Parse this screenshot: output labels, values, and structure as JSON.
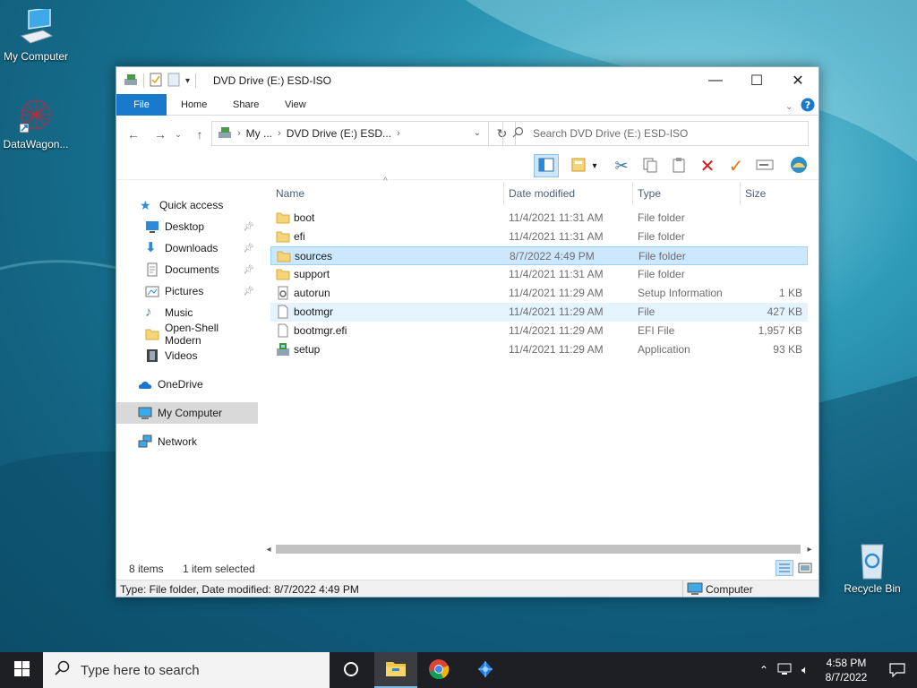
{
  "desktop": {
    "icons": [
      {
        "label": "My Computer"
      },
      {
        "label": "DataWagon..."
      },
      {
        "label": "Recycle Bin"
      }
    ]
  },
  "window": {
    "title": "DVD Drive (E:) ESD-ISO",
    "tabs": [
      "File",
      "Home",
      "Share",
      "View"
    ],
    "address": {
      "crumbs": [
        "My ...",
        "DVD Drive (E:) ESD..."
      ]
    },
    "search": {
      "placeholder": "Search DVD Drive (E:) ESD-ISO"
    },
    "nav": {
      "quick_access": "Quick access",
      "items": [
        {
          "label": "Desktop",
          "pinned": true
        },
        {
          "label": "Downloads",
          "pinned": true
        },
        {
          "label": "Documents",
          "pinned": true
        },
        {
          "label": "Pictures",
          "pinned": true
        },
        {
          "label": "Music",
          "pinned": false
        },
        {
          "label": "Open-Shell Modern",
          "pinned": false
        },
        {
          "label": "Videos",
          "pinned": false
        }
      ],
      "onedrive": "OneDrive",
      "my_computer": "My Computer",
      "network": "Network"
    },
    "columns": [
      "Name",
      "Date modified",
      "Type",
      "Size"
    ],
    "files": [
      {
        "name": "boot",
        "date": "11/4/2021 11:31 AM",
        "type": "File folder",
        "size": "",
        "icon": "folder-icon"
      },
      {
        "name": "efi",
        "date": "11/4/2021 11:31 AM",
        "type": "File folder",
        "size": "",
        "icon": "folder-icon"
      },
      {
        "name": "sources",
        "date": "8/7/2022 4:49 PM",
        "type": "File folder",
        "size": "",
        "icon": "folder-icon"
      },
      {
        "name": "support",
        "date": "11/4/2021 11:31 AM",
        "type": "File folder",
        "size": "",
        "icon": "folder-icon"
      },
      {
        "name": "autorun",
        "date": "11/4/2021 11:29 AM",
        "type": "Setup Information",
        "size": "1 KB",
        "icon": "settings-file-icon"
      },
      {
        "name": "bootmgr",
        "date": "11/4/2021 11:29 AM",
        "type": "File",
        "size": "427 KB",
        "icon": "file-icon"
      },
      {
        "name": "bootmgr.efi",
        "date": "11/4/2021 11:29 AM",
        "type": "EFI File",
        "size": "1,957 KB",
        "icon": "file-icon"
      },
      {
        "name": "setup",
        "date": "11/4/2021 11:29 AM",
        "type": "Application",
        "size": "93 KB",
        "icon": "setup-app-icon"
      }
    ],
    "status": {
      "item_count": "8 items",
      "selected": "1 item selected",
      "details": "Type: File folder, Date modified: 8/7/2022 4:49 PM",
      "location": "Computer"
    }
  },
  "taskbar": {
    "search_placeholder": "Type here to search",
    "time": "4:58 PM",
    "date": "8/7/2022"
  },
  "colors": {
    "accent": "#1979ca",
    "selection": "#cce8ff",
    "taskbar": "#1d1f22"
  }
}
